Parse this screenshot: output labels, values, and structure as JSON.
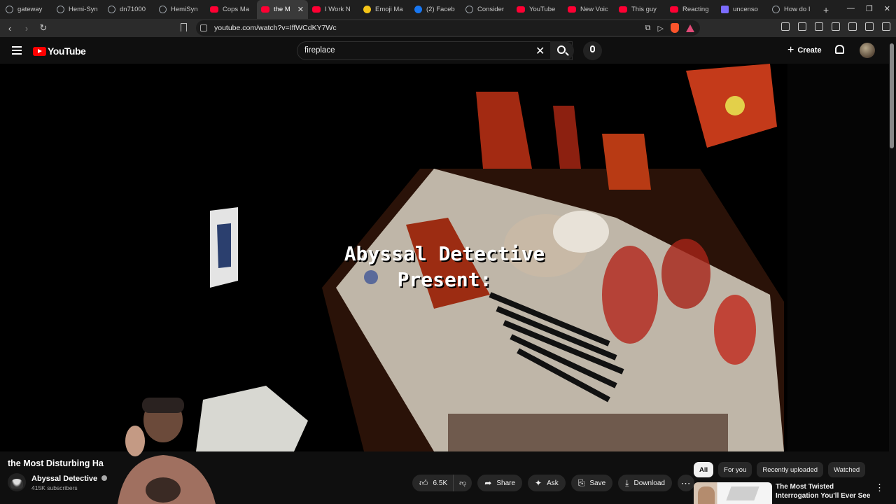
{
  "browser": {
    "tabs": [
      {
        "title": "gateway",
        "favicon": "generic-icon"
      },
      {
        "title": "Hemi-Syn",
        "favicon": "generic-icon"
      },
      {
        "title": "dn71000",
        "favicon": "generic-icon"
      },
      {
        "title": "HemiSyn",
        "favicon": "generic-icon"
      },
      {
        "title": "Cops Ma",
        "favicon": "youtube-icon"
      },
      {
        "title": "the M",
        "favicon": "youtube-icon",
        "active": true
      },
      {
        "title": "I Work N",
        "favicon": "youtube-icon"
      },
      {
        "title": "Emoji Ma",
        "favicon": "emoji-icon"
      },
      {
        "title": "(2) Faceb",
        "favicon": "facebook-icon"
      },
      {
        "title": "Consider",
        "favicon": "generic-icon"
      },
      {
        "title": "YouTube",
        "favicon": "youtube-icon"
      },
      {
        "title": "New Voic",
        "favicon": "youtube-icon"
      },
      {
        "title": "This guy",
        "favicon": "youtube-icon"
      },
      {
        "title": "Reacting",
        "favicon": "youtube-icon"
      },
      {
        "title": "uncenso",
        "favicon": "generic-icon"
      },
      {
        "title": "How do I",
        "favicon": "generic-icon"
      }
    ],
    "url": "youtube.com/watch?v=IffWCdKY7Wc"
  },
  "youtube": {
    "logo_text": "YouTube",
    "search_query": "fireplace",
    "create_label": "Create"
  },
  "video": {
    "overlay_line1": "Abyssal Detective",
    "overlay_line2": "Present:",
    "title": "the Most Disturbing Ha",
    "channel": "Abyssal Detective",
    "subscribers": "415K subscribers",
    "likes": "6.5K",
    "share_label": "Share",
    "ask_label": "Ask",
    "save_label": "Save",
    "download_label": "Download"
  },
  "sidebar": {
    "chips": [
      "All",
      "For you",
      "Recently uploaded",
      "Watched"
    ],
    "recommendation_title": "The Most Twisted Interrogation You'll Ever See"
  },
  "colors": {
    "background": "#0f0f0f",
    "youtube_red": "#ff0000",
    "pill_bg": "#272727"
  }
}
